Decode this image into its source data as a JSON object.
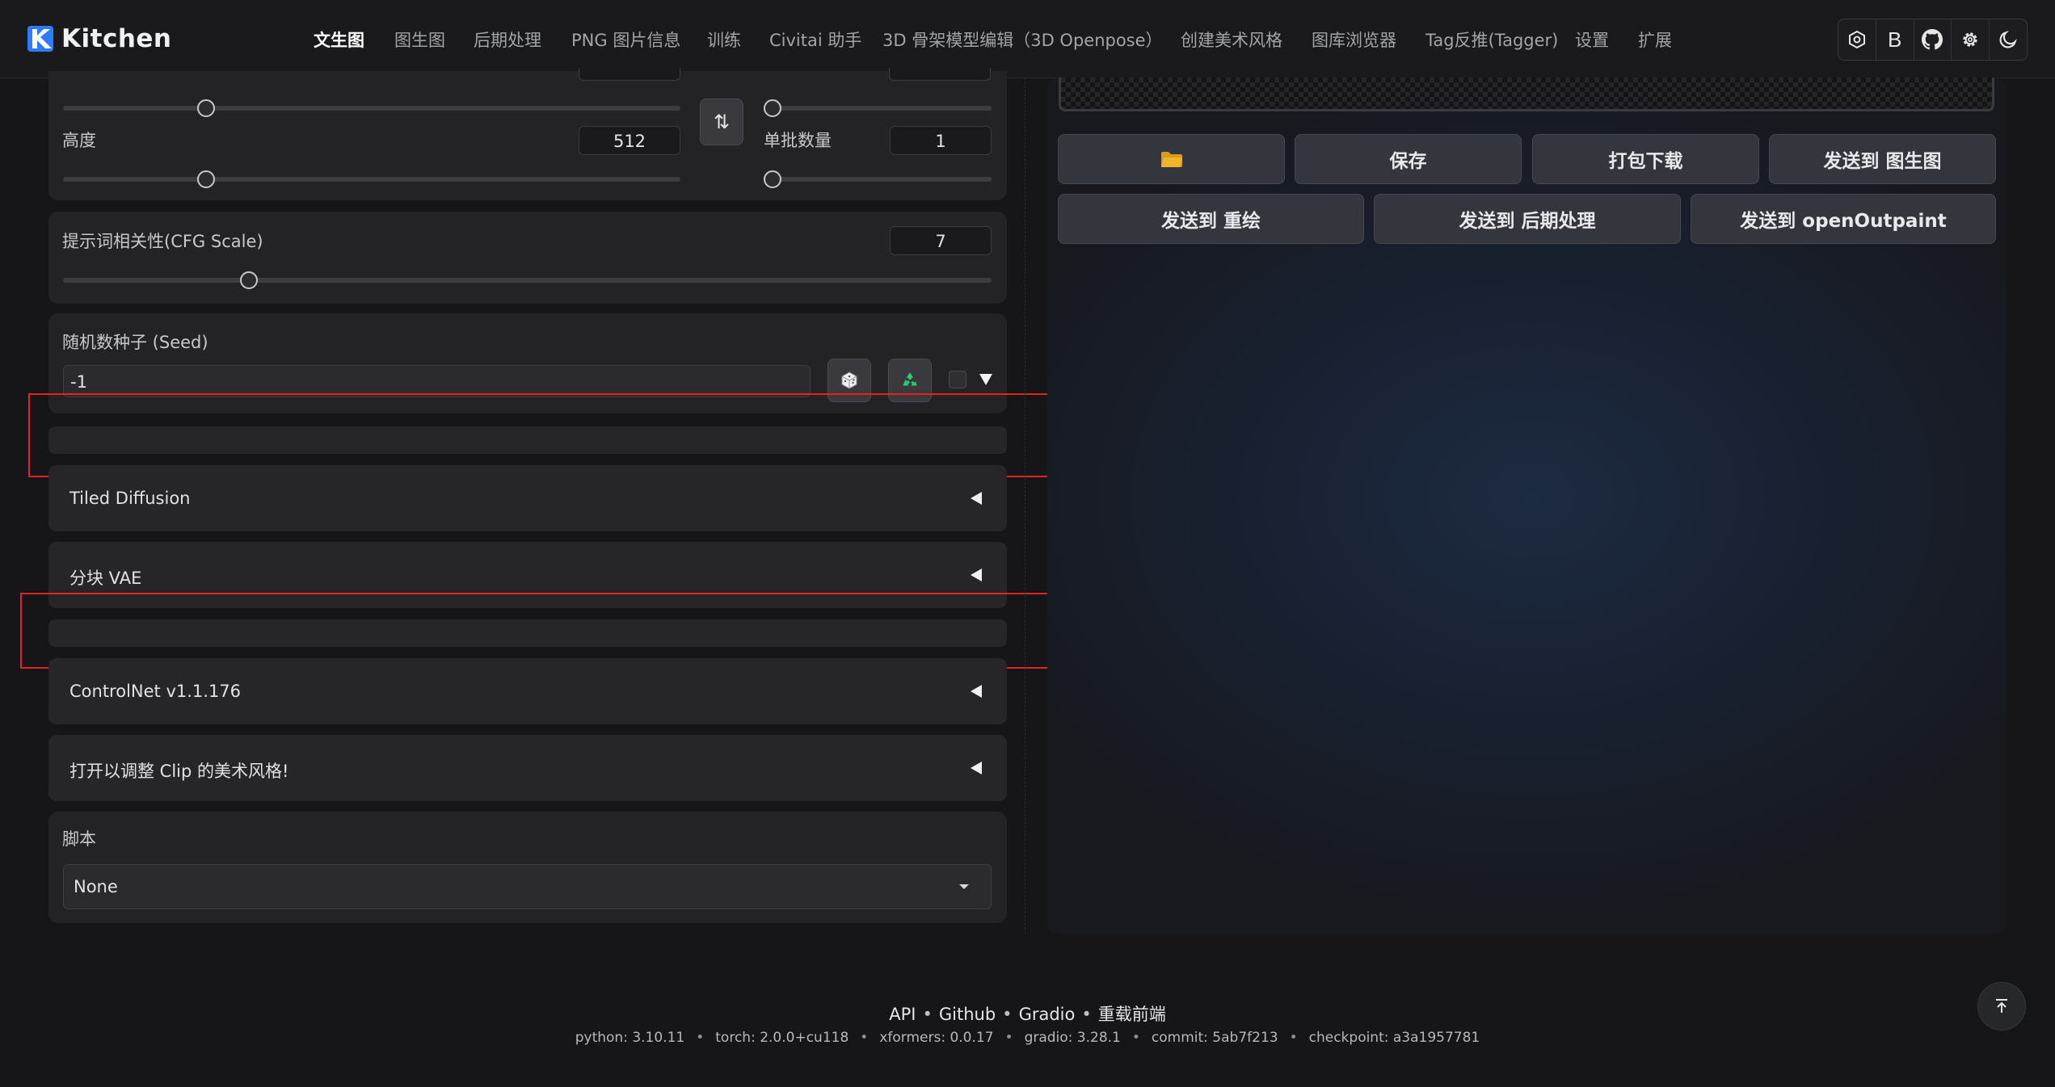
{
  "app": {
    "title": "Kitchen"
  },
  "nav": [
    {
      "label": "文生图",
      "active": true
    },
    {
      "label": "图生图"
    },
    {
      "label": "后期处理"
    },
    {
      "label": "PNG 图片信息"
    },
    {
      "label": "训练"
    },
    {
      "label": "Civitai 助手"
    },
    {
      "label": "3D 骨架模型编辑（3D Openpose）"
    },
    {
      "label": "创建美术风格"
    },
    {
      "label": "图库浏览器"
    },
    {
      "label": "Tag反推(Tagger)"
    },
    {
      "label": "设置"
    },
    {
      "label": "扩展"
    }
  ],
  "header_icons": [
    {
      "name": "hexagon-settings-icon",
      "glyph": "⚙"
    },
    {
      "name": "bold-b-icon",
      "glyph": "B"
    },
    {
      "name": "github-icon",
      "glyph": ""
    },
    {
      "name": "gear-icon",
      "glyph": "⚙"
    },
    {
      "name": "moon-icon",
      "glyph": "☾"
    }
  ],
  "size_panel": {
    "height_label": "高度",
    "height_value": "512",
    "batch_size_label": "单批数量",
    "batch_size_value": "1",
    "swap_icon": "⇅"
  },
  "cfg": {
    "label": "提示词相关性(CFG Scale)",
    "value": "7",
    "level": 0.2
  },
  "seed": {
    "label": "随机数种子 (Seed)",
    "value": "-1"
  },
  "accordions": [
    {
      "title": "Tiled Diffusion"
    },
    {
      "title": "分块 VAE"
    },
    {
      "title": "ControlNet v1.1.176"
    },
    {
      "title": "打开以调整 Clip 的美术风格!"
    }
  ],
  "script": {
    "label": "脚本",
    "value": "None"
  },
  "actions": {
    "save": "保存",
    "zip": "打包下载",
    "send_img2img": "发送到 图生图",
    "send_inpaint": "发送到 重绘",
    "send_extras": "发送到 后期处理",
    "send_openoutpaint": "发送到 openOutpaint"
  },
  "footer": {
    "links": [
      "API",
      "Github",
      "Gradio",
      "重载前端"
    ],
    "info": [
      "python: 3.10.11",
      "torch: 2.0.0+cu118",
      "xformers: 0.0.17",
      "gradio: 3.28.1",
      "commit: 5ab7f213",
      "checkpoint: a3a1957781"
    ]
  },
  "colors": {
    "accent": "#2f7bff",
    "highlight_box": "#e02424",
    "folder": "#f0b429",
    "recycle": "#2ecc71"
  }
}
